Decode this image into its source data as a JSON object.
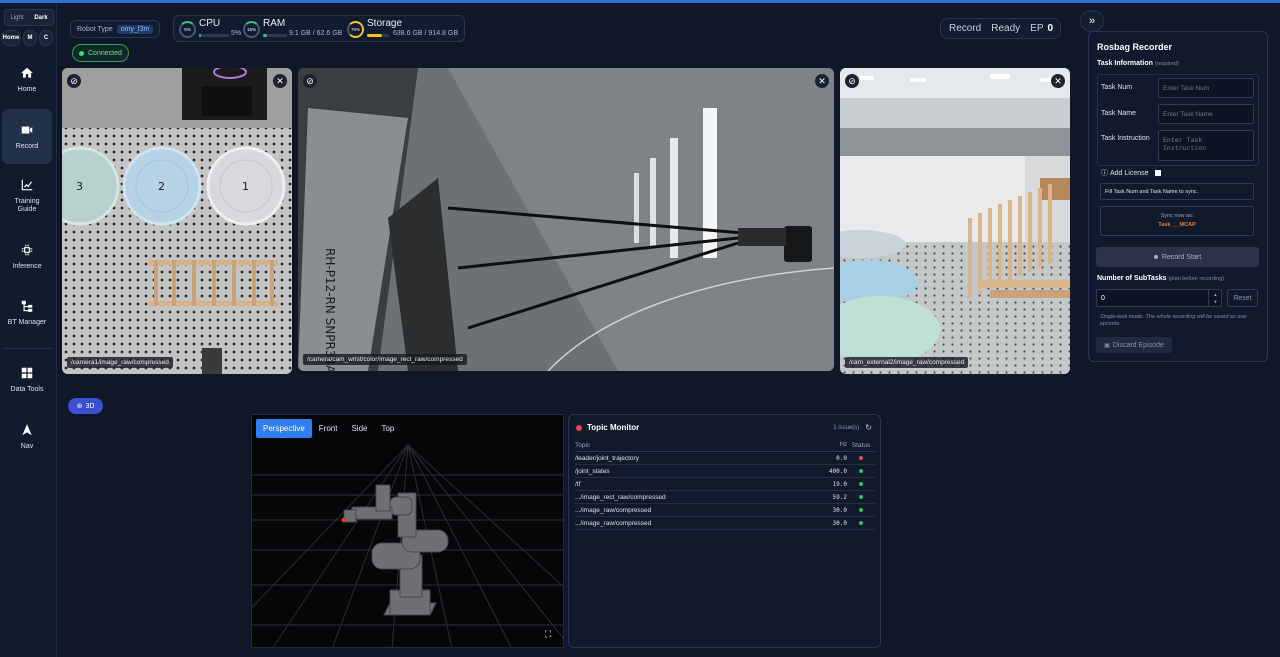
{
  "theme": {
    "light": "Light",
    "dark": "Dark"
  },
  "modes": {
    "home": "Home",
    "m": "M",
    "c": "C"
  },
  "nav": [
    {
      "label": "Home",
      "icon": "home-icon"
    },
    {
      "label": "Record",
      "icon": "camera-icon"
    },
    {
      "label": "Training Guide",
      "icon": "chart-icon"
    },
    {
      "label": "Inference",
      "icon": "chip-icon"
    },
    {
      "label": "BT Manager",
      "icon": "tree-icon"
    },
    {
      "label": "Data Tools",
      "icon": "grid-icon"
    },
    {
      "label": "Nav",
      "icon": "navigation-icon"
    }
  ],
  "header": {
    "robot_type_label": "Robot Type",
    "robot_type_value": "omy_f3m",
    "connection": "Connected",
    "cpu": {
      "name": "CPU",
      "ring": "5%",
      "value": "5%",
      "percent": 5
    },
    "ram": {
      "name": "RAM",
      "ring": "15%",
      "value": "9.1 GB / 62.6 GB",
      "percent": 15
    },
    "storage": {
      "name": "Storage",
      "ring": "70%",
      "value": "638.6 GB / 914.8 GB",
      "percent": 70
    },
    "record_label": "Record",
    "status": "Ready",
    "ep_label": "EP",
    "ep_value": "0"
  },
  "cameras": [
    {
      "topic": "/camera1/image_raw/compressed"
    },
    {
      "topic": "/camera/cam_wrist/color/image_rect_raw/compressed"
    },
    {
      "topic": "/cam_external2/image_raw/compressed"
    }
  ],
  "scene_labels": {
    "plate3": "3",
    "plate2": "2",
    "plate1": "1",
    "sticker": "RH-P12-RN SNPR34A0837"
  },
  "viewer": {
    "toggle_label": "3D",
    "tabs": [
      "Perspective",
      "Front",
      "Side",
      "Top"
    ]
  },
  "topic_monitor": {
    "title": "Topic Monitor",
    "issues": "1 issue(s)",
    "columns": {
      "topic": "Topic",
      "hz": "Hz",
      "status": "Status"
    },
    "rows": [
      {
        "topic": "/leader/joint_trajectory",
        "hz": "0.0",
        "status_color": "#ef4444"
      },
      {
        "topic": "/joint_states",
        "hz": "400.0",
        "status_color": "#22c55e"
      },
      {
        "topic": "/tf",
        "hz": "19.0",
        "status_color": "#22c55e"
      },
      {
        "topic": ".../image_rect_raw/compressed",
        "hz": "59.2",
        "status_color": "#22c55e"
      },
      {
        "topic": ".../image_raw/compressed",
        "hz": "30.0",
        "status_color": "#22c55e"
      },
      {
        "topic": ".../image_raw/compressed",
        "hz": "30.0",
        "status_color": "#22c55e"
      }
    ]
  },
  "rosbag": {
    "title": "Rosbag Recorder",
    "task_info": "Task Information",
    "required": "(required)",
    "task_num_label": "Task Num",
    "task_num_placeholder": "Enter Task Num",
    "task_name_label": "Task Name",
    "task_name_placeholder": "Enter Task Name",
    "task_instruction_label": "Task Instruction",
    "task_instruction_placeholder": "Enter Task Instruction",
    "add_license": "Add License",
    "hint": "Fill Task Num and Task Name to sync.",
    "sync_label": "Sync now as:",
    "sync_name": "Task___MCAP",
    "record_start": "Record Start",
    "subtasks_label": "Number of SubTasks",
    "subtasks_hint": "(plan before recording)",
    "subtasks_value": "0",
    "reset": "Reset",
    "note": "Single-task mode. The whole recording will be saved as one episode.",
    "discard": "Discard Episode"
  }
}
